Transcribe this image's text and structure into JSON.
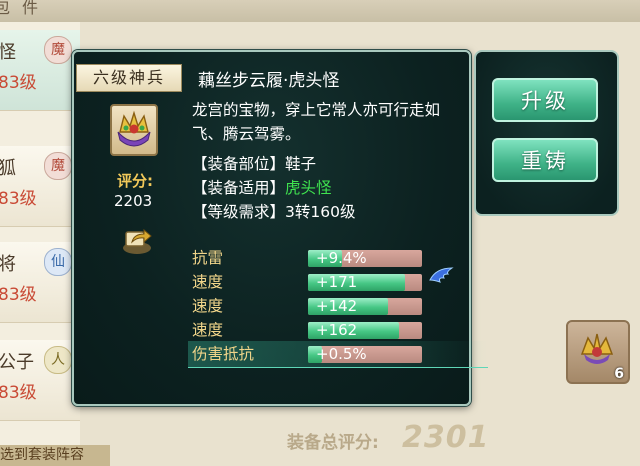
{
  "background": {
    "top_tabs": [
      "包",
      "件"
    ],
    "list_items": [
      {
        "name": "怪",
        "level": "83级",
        "tag": "魔"
      },
      {
        "name": "狐",
        "level": "83级",
        "tag": "魔"
      },
      {
        "name": "将",
        "level": "83级",
        "tag": "仙"
      },
      {
        "name": "公子",
        "level": "83级",
        "tag": "人"
      }
    ],
    "bottom_left_text": "选到套装阵容",
    "total_score_label": "装备总评分:",
    "total_score_value": "2301",
    "slot_count": "6"
  },
  "tooltip": {
    "tier": "六级神兵",
    "item_name": "藕丝步云履·虎头怪",
    "score_label": "评分:",
    "score_value": "2203",
    "description": "龙宫的宝物，穿上它常人亦可行走如飞、腾云驾雾。",
    "info": [
      {
        "label": "【装备部位】",
        "value": "鞋子"
      },
      {
        "label": "【装备适用】",
        "value": "虎头怪"
      },
      {
        "label": "【等级需求】",
        "value": "3转160级"
      }
    ],
    "attributes": [
      {
        "label": "抗雷",
        "value": "+9.4%",
        "fill": 0.3
      },
      {
        "label": "速度",
        "value": "+171",
        "fill": 0.85
      },
      {
        "label": "速度",
        "value": "+142",
        "fill": 0.7
      },
      {
        "label": "速度",
        "value": "+162",
        "fill": 0.8
      },
      {
        "label": "伤害抵抗",
        "value": "+0.5%",
        "fill": 0.12
      }
    ]
  },
  "actions": {
    "upgrade_label": "升级",
    "recast_label": "重铸"
  },
  "colors": {
    "panel_bg": "#0c2120",
    "panel_border": "#a9c9be",
    "button_green": "#3fb287",
    "score_gold": "#f2c95a",
    "attr_label": "#f1d58a",
    "applicable_green": "#3fe24f",
    "bar_track": "#c99a90",
    "bar_fill": "#46c785"
  }
}
